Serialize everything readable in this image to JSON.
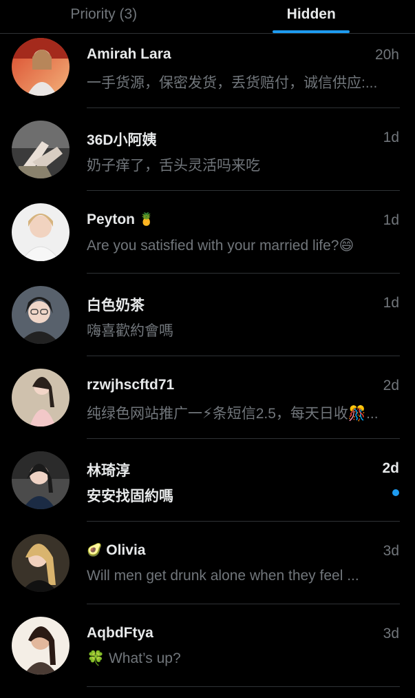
{
  "tabs": {
    "priority": "Priority (3)",
    "hidden": "Hidden"
  },
  "colors": {
    "accent": "#1d9bf0",
    "background": "#000000",
    "text_primary": "#e7e9ea",
    "text_secondary": "#71767b"
  },
  "conversations": [
    {
      "name": "Amirah Lara",
      "name_emoji_icon": "",
      "time": "20h",
      "preview": "一手货源，保密发货，丢货赔付，诚信供应:..."
    },
    {
      "name": "36D小阿姨",
      "name_emoji_icon": "",
      "time": "1d",
      "preview": "奶子痒了，舌头灵活吗来吃"
    },
    {
      "name": "Peyton",
      "name_emoji_icon": "pineapple-emoji-icon",
      "name_emoji": "🍍",
      "time": "1d",
      "preview": "Are you satisfied with your married life?😄"
    },
    {
      "name": "白色奶茶",
      "name_emoji_icon": "",
      "time": "1d",
      "preview": "嗨喜歡約會嗎"
    },
    {
      "name": "rzwjhscftd71",
      "name_emoji_icon": "",
      "time": "2d",
      "preview": "纯绿色网站推广一⚡条短信2.5，每天日收🎊..."
    },
    {
      "name": "林琦淳",
      "name_emoji_icon": "",
      "time": "2d",
      "preview": "安安找固約嗎",
      "unread": true
    },
    {
      "name": "Olivia",
      "name_emoji_icon": "avocado-emoji-icon",
      "name_emoji": "🥑",
      "time": "3d",
      "preview": "Will men get drunk alone when they feel ..."
    },
    {
      "name": "AqbdFtya",
      "name_emoji_icon": "",
      "time": "3d",
      "preview": "🍀 What’s up?"
    }
  ]
}
